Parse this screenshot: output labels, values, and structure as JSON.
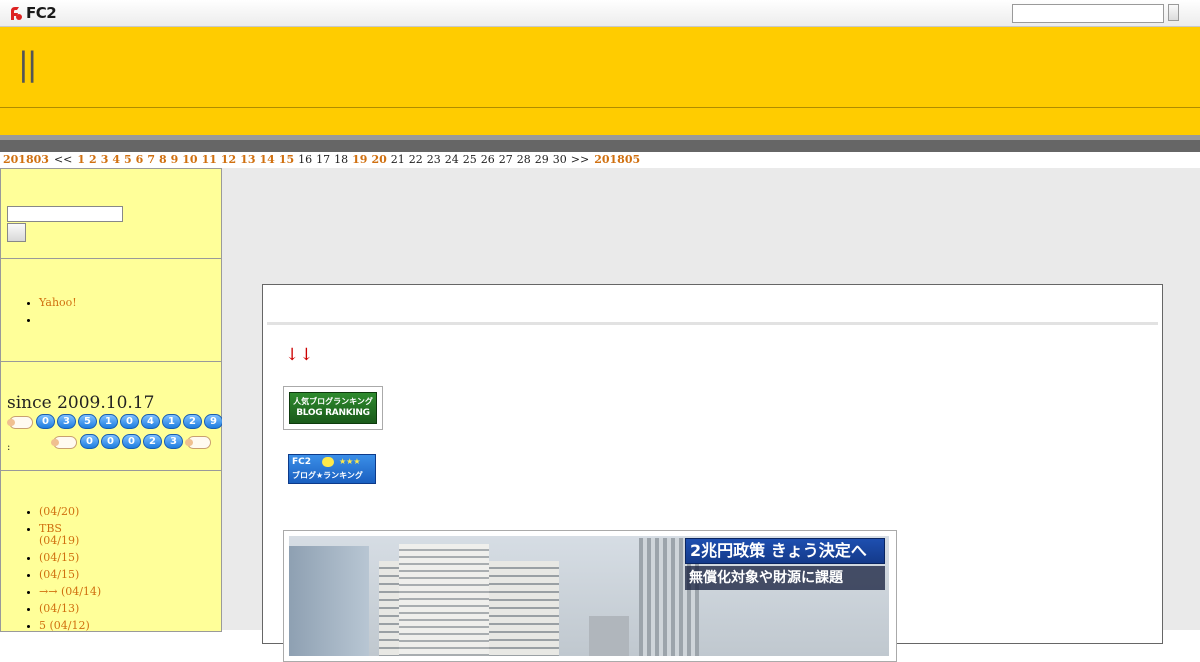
{
  "fc2bar": {
    "logo_text": "FC2",
    "search": {
      "placeholder": "",
      "value": ""
    }
  },
  "header": {
    "title": "||"
  },
  "calendar": {
    "prev_month": "201803",
    "prev_nav": "<<",
    "days": [
      {
        "label": "1",
        "linked": true
      },
      {
        "label": "2",
        "linked": true
      },
      {
        "label": "3",
        "linked": true
      },
      {
        "label": "4",
        "linked": true
      },
      {
        "label": "5",
        "linked": true
      },
      {
        "label": "6",
        "linked": true
      },
      {
        "label": "7",
        "linked": true
      },
      {
        "label": "8",
        "linked": true
      },
      {
        "label": "9",
        "linked": true
      },
      {
        "label": "10",
        "linked": true
      },
      {
        "label": "11",
        "linked": true
      },
      {
        "label": "12",
        "linked": true
      },
      {
        "label": "13",
        "linked": true
      },
      {
        "label": "14",
        "linked": true
      },
      {
        "label": "15",
        "linked": true
      },
      {
        "label": "16",
        "linked": false
      },
      {
        "label": "17",
        "linked": false
      },
      {
        "label": "18",
        "linked": false
      },
      {
        "label": "19",
        "linked": true
      },
      {
        "label": "20",
        "linked": true
      },
      {
        "label": "21",
        "linked": false
      },
      {
        "label": "22",
        "linked": false
      },
      {
        "label": "23",
        "linked": false
      },
      {
        "label": "24",
        "linked": false
      },
      {
        "label": "25",
        "linked": false
      },
      {
        "label": "26",
        "linked": false
      },
      {
        "label": "27",
        "linked": false
      },
      {
        "label": "28",
        "linked": false
      },
      {
        "label": "29",
        "linked": false
      },
      {
        "label": "30",
        "linked": false
      }
    ],
    "next_nav": ">>",
    "next_month": "201805"
  },
  "sidebar": {
    "search": {
      "value": ""
    },
    "links": [
      {
        "label": "Yahoo!"
      },
      {
        "label": ""
      }
    ],
    "counter": {
      "since": "since 2009.10.17",
      "total_digits": [
        "0",
        "3",
        "5",
        "1",
        "0",
        "4",
        "1",
        "2",
        "9"
      ],
      "today_digits": [
        "0",
        "0",
        "0",
        "2",
        "3"
      ],
      "colon": ":"
    },
    "recent_entries": [
      {
        "title": "",
        "date": "(04/20)"
      },
      {
        "title": "TBS",
        "date": "(04/19)"
      },
      {
        "title": "",
        "date": "(04/15)"
      },
      {
        "title": "",
        "date": "(04/15)"
      },
      {
        "title": "→→",
        "date": "(04/14)"
      },
      {
        "title": "",
        "date": "(04/13)"
      },
      {
        "title": "5",
        "date": "(04/12)"
      }
    ]
  },
  "entry": {
    "arrows": "↓↓",
    "banner1": {
      "line1": "人気ブログランキング",
      "line2": "BLOG RANKING"
    },
    "banner2": {
      "line1": "FC2",
      "line2": "ブログ★ランキング",
      "stars": "★★★"
    },
    "photo_caption": {
      "line1": "2兆円政策 きょう決定へ",
      "line2": "無償化対象や財源に課題"
    }
  },
  "colors": {
    "header_yellow": "#ffcc00",
    "sidebar_yellow": "#ffff99",
    "link_orange": "#d07010",
    "arrow_red": "#cc0000",
    "main_grey": "#eaeaea"
  }
}
